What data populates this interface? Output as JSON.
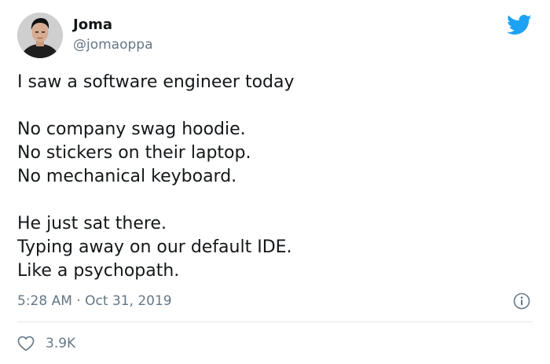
{
  "author": {
    "name": "Joma",
    "handle": "@jomaoppa",
    "avatar_icon": "profile-photo"
  },
  "tweet": {
    "lines": [
      "I saw a software engineer today",
      "",
      "No company swag hoodie.",
      "No stickers on their laptop.",
      "No mechanical keyboard.",
      "",
      "He just sat there.",
      "Typing away on our default IDE.",
      "Like a psychopath."
    ],
    "timestamp": "5:28 AM · Oct 31, 2019",
    "like_count": "3.9K"
  },
  "icons": {
    "brand": "twitter-bird-icon",
    "info": "info-icon",
    "like": "heart-icon"
  },
  "colors": {
    "brand_blue": "#1da1f2",
    "secondary_text": "#657786",
    "primary_text": "#14171a",
    "divider": "#e1e8ed"
  }
}
